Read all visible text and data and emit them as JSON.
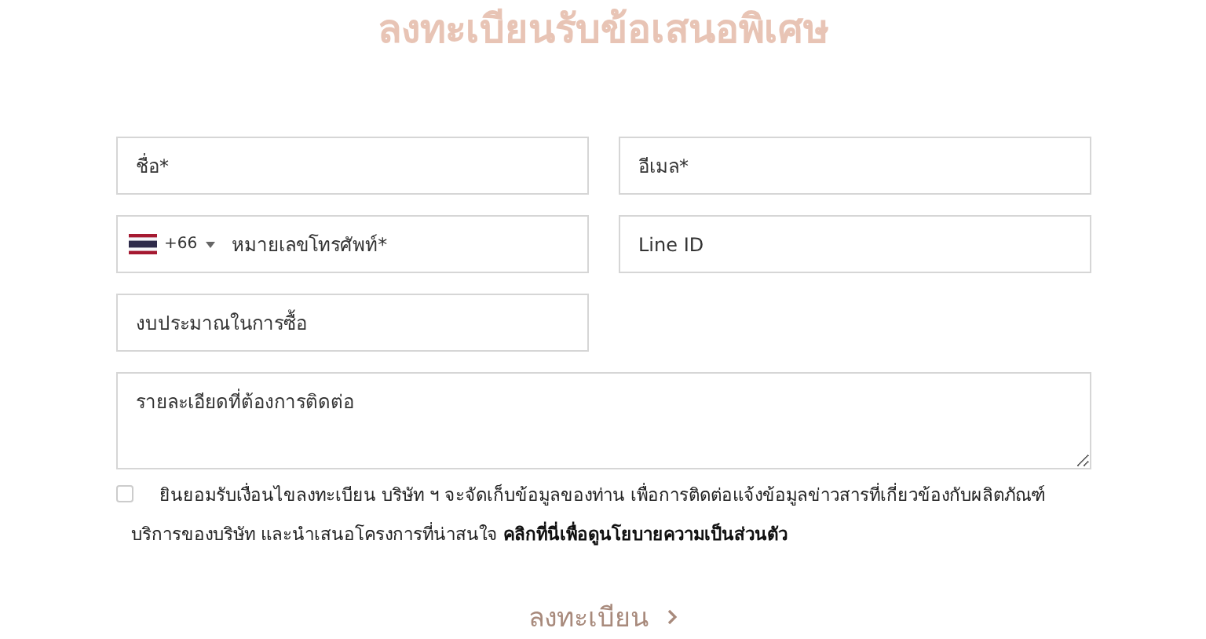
{
  "title": "ลงทะเบียนรับข้อเสนอพิเศษ",
  "fields": [
    {
      "kind": "text",
      "placeholder": "ชื่อ*"
    },
    {
      "kind": "text",
      "placeholder": "อีเมล*"
    },
    {
      "kind": "phone",
      "dial_code": "+66",
      "placeholder": "หมายเลขโทรศัพท์*"
    },
    {
      "kind": "text",
      "placeholder": "Line ID"
    },
    {
      "kind": "text",
      "placeholder": "งบประมาณในการซื้อ"
    },
    {
      "kind": "textarea",
      "placeholder": "รายละเอียดที่ต้องการติดต่อ"
    }
  ],
  "consent": {
    "checked": false,
    "text": "ยินยอมรับเงื่อนไขลงทะเบียน บริษัท ฯ จะจัดเก็บข้อมูลของท่าน เพื่อการติดต่อแจ้งข้อมูลข่าวสารที่เกี่ยวข้องกับผลิตภัณฑ์ บริการของบริษัท และนำเสนอโครงการที่น่าสนใจ",
    "link": "คลิกที่นี่เพื่อดูนโยบายความเป็นส่วนตัว"
  },
  "submit": {
    "label": "ลงทะเบียน",
    "disabled": true
  }
}
